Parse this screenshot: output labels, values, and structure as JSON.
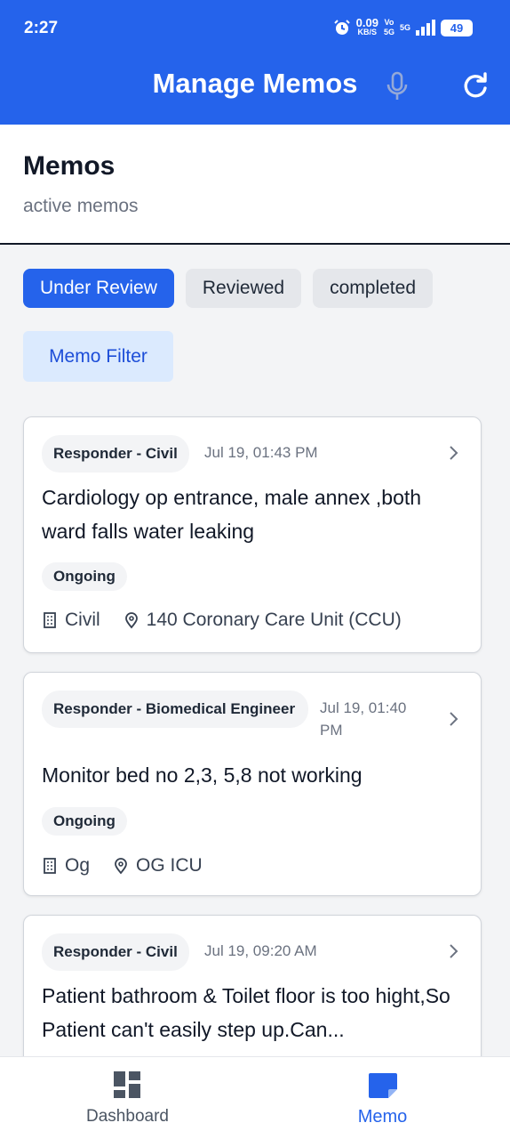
{
  "status_bar": {
    "time": "2:27",
    "net_speed": "0.09",
    "net_unit": "KB/S",
    "volte": "Vo",
    "volte_sub": "5G",
    "network": "5G",
    "battery": "49"
  },
  "app_bar": {
    "title": "Manage Memos",
    "mic_icon": "microphone-icon",
    "refresh_icon": "refresh-icon"
  },
  "header": {
    "title": "Memos",
    "subtitle": "active memos"
  },
  "tabs": [
    {
      "label": "Under Review",
      "active": true
    },
    {
      "label": "Reviewed",
      "active": false
    },
    {
      "label": "completed",
      "active": false
    }
  ],
  "filter": {
    "label": "Memo Filter"
  },
  "memos": [
    {
      "responder": "Responder - Civil",
      "time": "Jul 19, 01:43 PM",
      "title": "Cardiology op entrance, male annex ,both ward falls water leaking",
      "status": "Ongoing",
      "department": "Civil",
      "location": "140 Coronary Care Unit (CCU)"
    },
    {
      "responder": "Responder - Biomedical Engineer",
      "time": "Jul 19, 01:40 PM",
      "title": "Monitor bed no 2,3, 5,8 not working",
      "status": "Ongoing",
      "department": "Og",
      "location": "OG ICU"
    },
    {
      "responder": "Responder - Civil",
      "time": "Jul 19, 09:20 AM",
      "title": "Patient bathroom & Toilet floor is too hight,So Patient can't easily step up.Can..."
    }
  ],
  "bottom_nav": {
    "items": [
      {
        "label": "Dashboard",
        "icon": "dashboard-icon",
        "active": false
      },
      {
        "label": "Memo",
        "icon": "memo-icon",
        "active": true
      }
    ]
  },
  "colors": {
    "primary": "#2563eb",
    "active_nav": "#2563eb",
    "inactive_nav": "#4b5563"
  }
}
